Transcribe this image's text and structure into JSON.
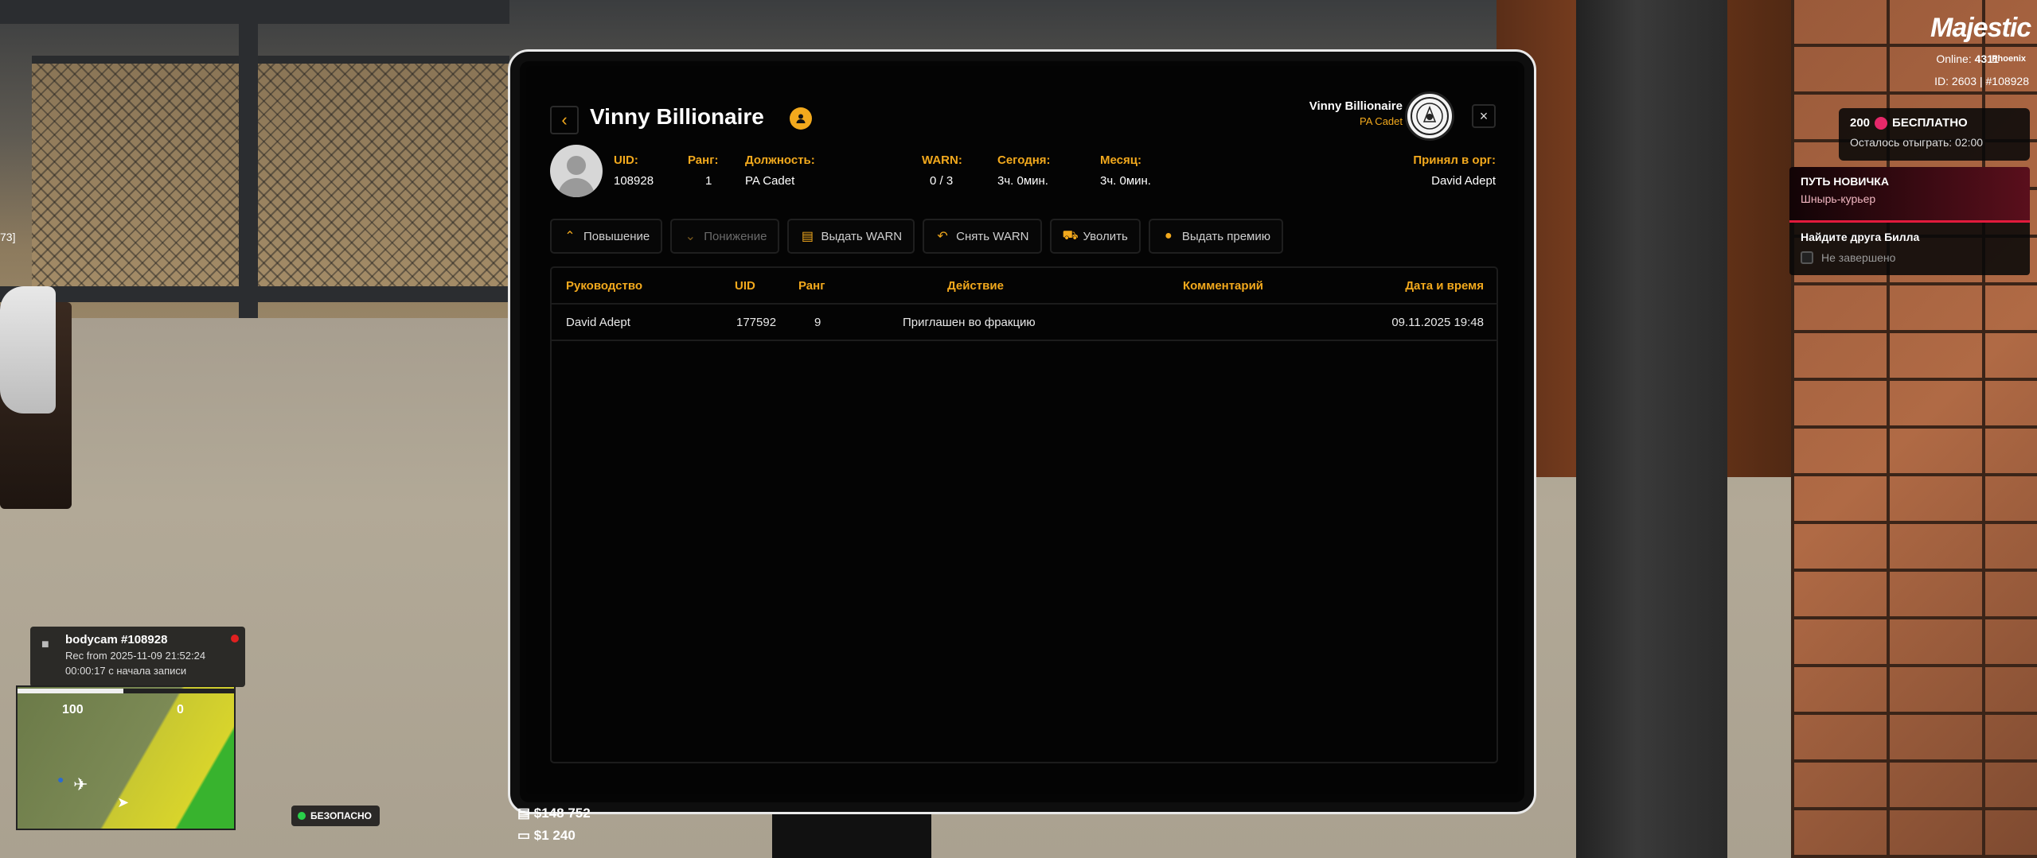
{
  "tablet": {
    "title": "Vinny Billionaire",
    "header_user": "Vinny Billionaire",
    "header_rank": "PA Cadet",
    "close_symbol": "×",
    "back_symbol": "‹",
    "profile": {
      "uid_label": "UID:",
      "uid_value": "108928",
      "rank_label": "Ранг:",
      "rank_value": "1",
      "position_label": "Должность:",
      "position_value": "PA Cadet",
      "warn_label": "WARN:",
      "warn_value": "0 / 3",
      "today_label": "Сегодня:",
      "today_value": "3ч. 0мин.",
      "month_label": "Месяц:",
      "month_value": "3ч. 0мин.",
      "accepted_label": "Принял в орг:",
      "accepted_value": "David Adept"
    },
    "actions": [
      {
        "label": "Повышение",
        "icon": "arrow-up-icon",
        "disabled": false
      },
      {
        "label": "Понижение",
        "icon": "arrow-down-icon",
        "disabled": true
      },
      {
        "label": "Выдать WARN",
        "icon": "warn-doc-icon",
        "disabled": false
      },
      {
        "label": "Снять WARN",
        "icon": "undo-icon",
        "disabled": false
      },
      {
        "label": "Уволить",
        "icon": "fire-user-icon",
        "disabled": false
      },
      {
        "label": "Выдать премию",
        "icon": "coin-icon",
        "disabled": false
      }
    ],
    "table": {
      "headers": [
        "Руководство",
        "UID",
        "Ранг",
        "Действие",
        "Комментарий",
        "Дата и время"
      ],
      "rows": [
        [
          "David Adept",
          "177592",
          "9",
          "Приглашен во фракцию",
          "",
          "09.11.2025 19:48"
        ]
      ]
    }
  },
  "hud": {
    "logo": "Majestic",
    "online_label": "Online:",
    "online_value": "4311",
    "server": "Phoenix",
    "id_line": "ID: 2603 | #108928",
    "bonus_title": "200",
    "bonus_free": "БЕСПЛАТНО",
    "bonus_sub": "Осталось отыграть: 02:00",
    "quest_title": "ПУТЬ НОВИЧКА",
    "quest_sub": "Шныpь-курьер",
    "task_title": "Найдите друга Билла",
    "task_status": "Не завершено",
    "bodycam_title": "bodycam #108928",
    "bodycam_line1": "Rec from 2025-11-09 21:52:24",
    "bodycam_line2": "00:00:17 с начала записи",
    "minimap_left": "100",
    "minimap_right": "0",
    "safe_label": "БЕЗОПАСНО",
    "money_bank": "$148 752",
    "money_cash": "$1 240",
    "side_text": "73]"
  },
  "colors": {
    "accent": "#f2a91d",
    "tablet_bg": "#040404",
    "border": "#1c1c1c"
  }
}
